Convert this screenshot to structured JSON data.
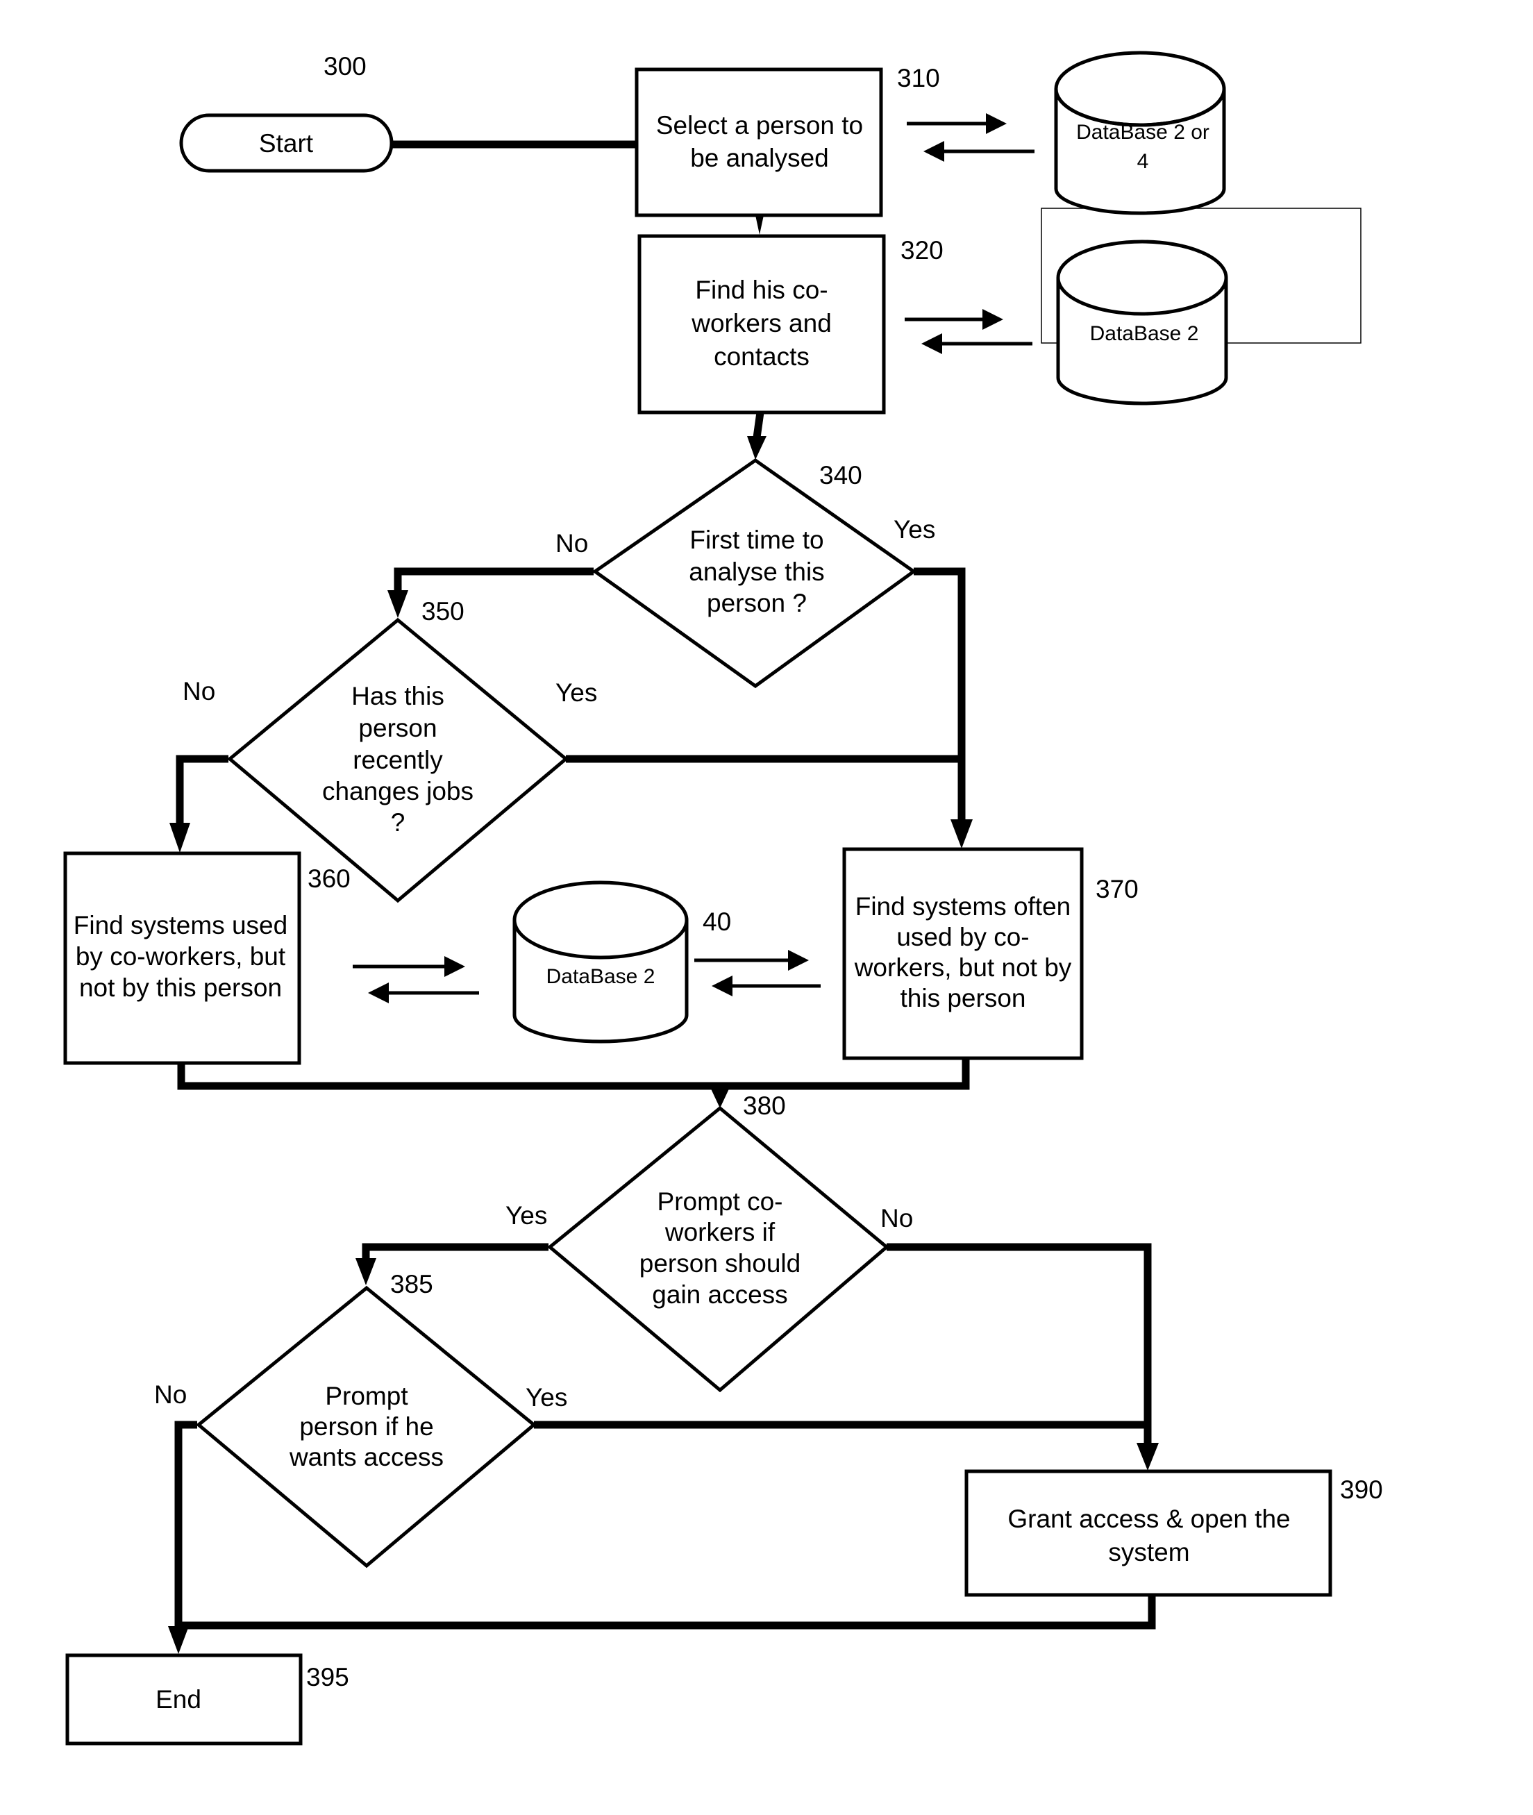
{
  "figure_ref": "300",
  "nodes": {
    "start": {
      "ref": "",
      "lines": [
        "Start"
      ]
    },
    "n310": {
      "ref": "310",
      "lines": [
        "Select a person to",
        "be analysed"
      ]
    },
    "n320": {
      "ref": "320",
      "lines": [
        "Find his co-",
        "workers and",
        "contacts"
      ]
    },
    "n340": {
      "ref": "340",
      "lines": [
        "First time to",
        "analyse this",
        "person ?"
      ],
      "yes": "Yes",
      "no": "No"
    },
    "n350": {
      "ref": "350",
      "lines": [
        "Has this",
        "person",
        "recently",
        "changes jobs",
        "?"
      ],
      "yes": "Yes",
      "no": "No"
    },
    "n360": {
      "ref": "360",
      "lines": [
        "Find systems used",
        "by co-workers, but",
        "not by this person"
      ]
    },
    "n370": {
      "ref": "370",
      "lines": [
        "Find systems often",
        "used by co-",
        "workers, but not by",
        "this person"
      ]
    },
    "n380": {
      "ref": "380",
      "lines": [
        "Prompt co-",
        "workers if",
        "person should",
        "gain access"
      ],
      "yes": "Yes",
      "no": "No"
    },
    "n385": {
      "ref": "385",
      "lines": [
        "Prompt",
        "person if he",
        "wants access"
      ],
      "yes": "Yes",
      "no": "No"
    },
    "n390": {
      "ref": "390",
      "lines": [
        "Grant access & open the",
        "system"
      ]
    },
    "n395": {
      "ref": "395",
      "lines": [
        "End"
      ]
    }
  },
  "databases": {
    "db_top": {
      "lines": [
        "DataBase 2 or",
        "4"
      ]
    },
    "db_mid": {
      "lines": [
        "DataBase 2"
      ]
    },
    "db_40": {
      "ref": "40",
      "lines": [
        "DataBase 2"
      ]
    }
  }
}
